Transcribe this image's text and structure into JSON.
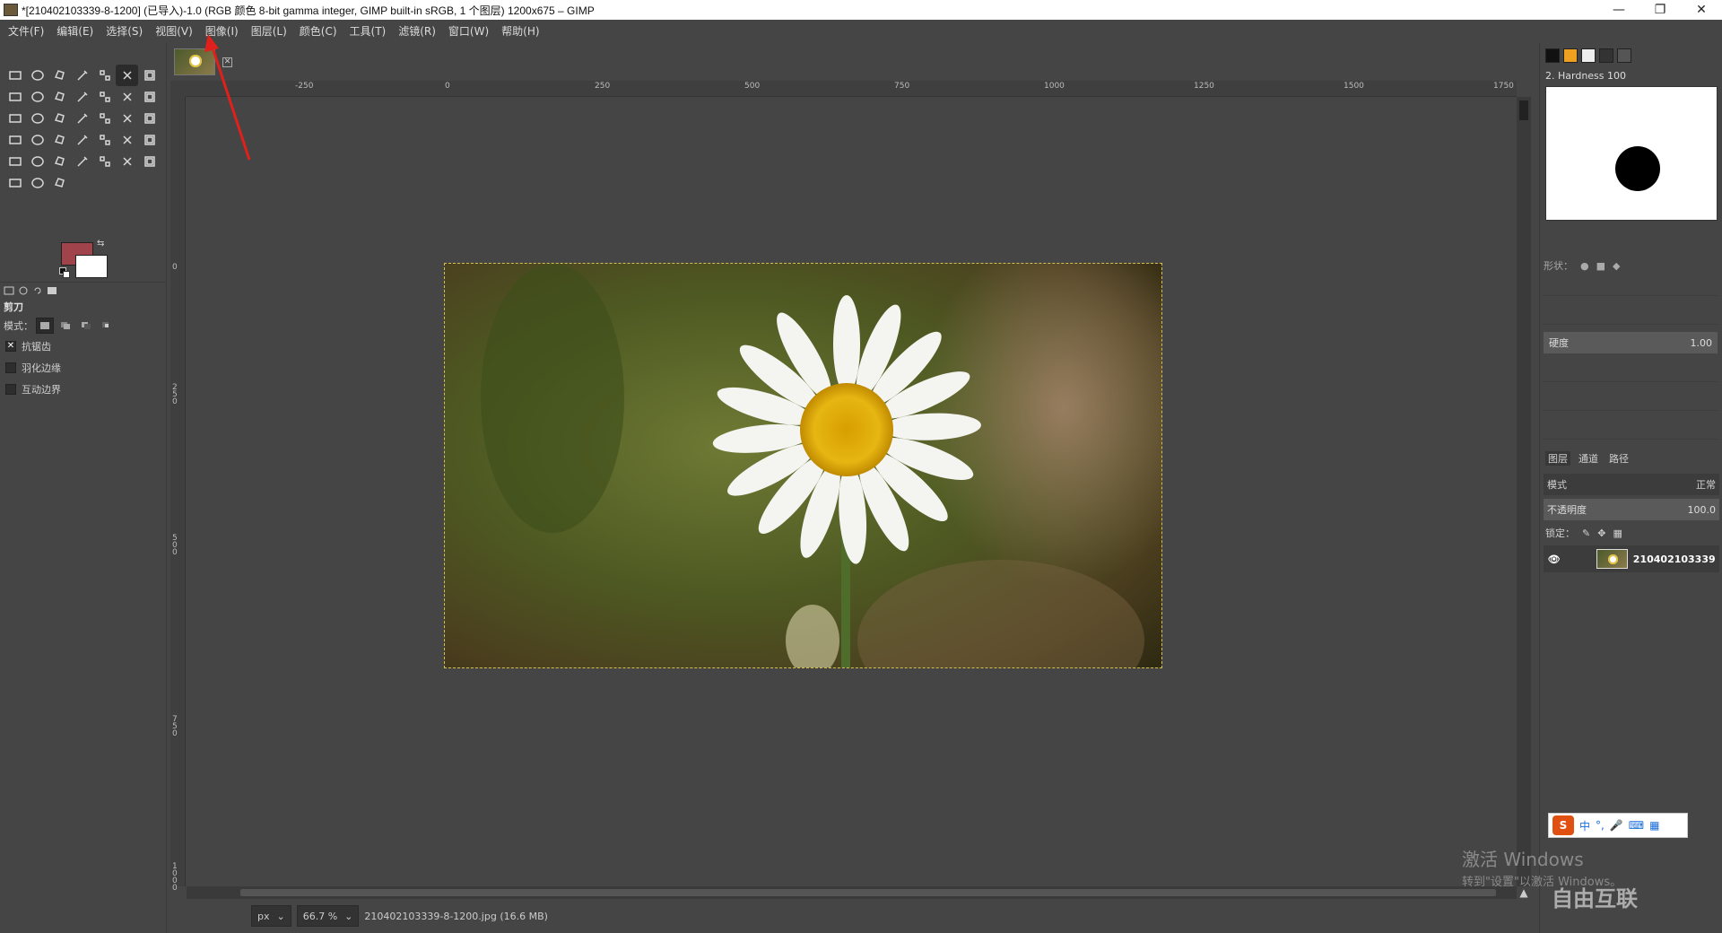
{
  "window": {
    "title": "*[210402103339-8-1200] (已导入)-1.0 (RGB 颜色 8-bit gamma integer, GIMP built-in sRGB, 1 个图层) 1200x675 – GIMP",
    "minimize_glyph": "—",
    "maximize_glyph": "❐",
    "close_glyph": "✕"
  },
  "menubar": [
    "文件(F)",
    "编辑(E)",
    "选择(S)",
    "视图(V)",
    "图像(I)",
    "图层(L)",
    "颜色(C)",
    "工具(T)",
    "滤镜(R)",
    "窗口(W)",
    "帮助(H)"
  ],
  "toolbox": {
    "tools": [
      "rect-select-icon",
      "ellipse-select-icon",
      "free-select-icon",
      "fuzzy-select-icon",
      "by-color-select-icon",
      "scissors-select-icon",
      "foreground-select-icon",
      "paths-icon",
      "color-picker-icon",
      "zoom-icon",
      "measure-icon",
      "move-icon",
      "align-icon",
      "crop-icon",
      "unified-transform-icon",
      "rotate-icon",
      "scale-icon",
      "shear-icon",
      "flip-icon",
      "perspective-icon",
      "warp-icon",
      "cage-icon",
      "handle-transform-icon",
      "text-icon",
      "bucket-fill-icon",
      "gradient-icon",
      "pencil-icon",
      "paintbrush-icon",
      "eraser-icon",
      "airbrush-icon",
      "ink-icon",
      "mypaint-brush-icon",
      "clone-icon",
      "heal-icon",
      "perspective-clone-icon",
      "blur-icon",
      "smudge-icon",
      "dodge-burn-icon"
    ],
    "active_tool_index": 5,
    "foreground_color": "#a0434a",
    "background_color": "#ffffff",
    "tool_options": {
      "tool_name": "剪刀",
      "mode_label": "模式：",
      "options": [
        {
          "label": "抗锯齿",
          "checked": true
        },
        {
          "label": "羽化边缘",
          "checked": false
        },
        {
          "label": "互动边界",
          "checked": false
        }
      ]
    }
  },
  "ruler": {
    "h_labels": [
      "-250",
      "0",
      "250",
      "500",
      "750",
      "1000",
      "1250",
      "1500",
      "1750"
    ],
    "v_labels": [
      "0",
      "2 5 0",
      "5 0 0",
      "7 5 0",
      "1 0 0 0"
    ]
  },
  "status": {
    "unit": "px",
    "zoom": "66.7 %",
    "file_info": "210402103339-8-1200.jpg (16.6 MB)"
  },
  "brushes": {
    "brush_name": "2. Hardness 100",
    "shape_label": "形状：",
    "hardness_label": "硬度",
    "hardness_value": "1.00"
  },
  "layers": {
    "tabs": [
      "图层",
      "通道",
      "路径"
    ],
    "mode_label": "模式",
    "mode_value": "正常",
    "opacity_label": "不透明度",
    "opacity_value": "100.0",
    "lock_label": "锁定：",
    "layer_name": "210402103339"
  },
  "ime": {
    "logo": "S",
    "items": [
      "中",
      "°,",
      "🎤",
      "⌨",
      "▦"
    ]
  },
  "overlay": {
    "activate_title": "激活 Windows",
    "activate_sub": "转到\"设置\"以激活 Windows。",
    "watermark": "自由互联",
    "arrow_color": "#e0201a"
  }
}
